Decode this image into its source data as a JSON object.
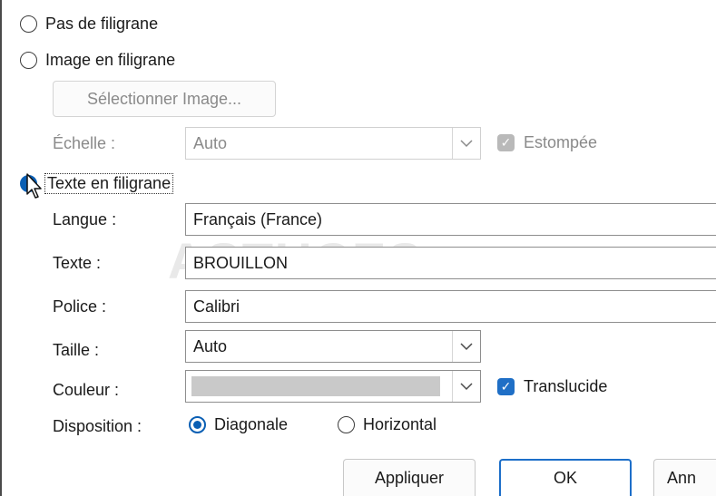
{
  "options": {
    "no_watermark": "Pas de filigrane",
    "image_watermark": "Image en filigrane",
    "text_watermark": "Texte en filigrane"
  },
  "image_section": {
    "select_button": "Sélectionner Image...",
    "scale_label": "Échelle :",
    "scale_value": "Auto",
    "washout_label": "Estompée"
  },
  "text_section": {
    "language_label": "Langue :",
    "language_value": "Français (France)",
    "text_label": "Texte :",
    "text_value": "BROUILLON",
    "font_label": "Police :",
    "font_value": "Calibri",
    "size_label": "Taille :",
    "size_value": "Auto",
    "color_label": "Couleur :",
    "color_value": "#c9c9c9",
    "translucent_label": "Translucide",
    "layout_label": "Disposition :",
    "layout_diagonal": "Diagonale",
    "layout_horizontal": "Horizontal"
  },
  "buttons": {
    "apply": "Appliquer",
    "ok": "OK",
    "cancel": "Ann"
  },
  "watermark_logo": "ASTUCES",
  "colors": {
    "accent": "#1f6fc6"
  }
}
